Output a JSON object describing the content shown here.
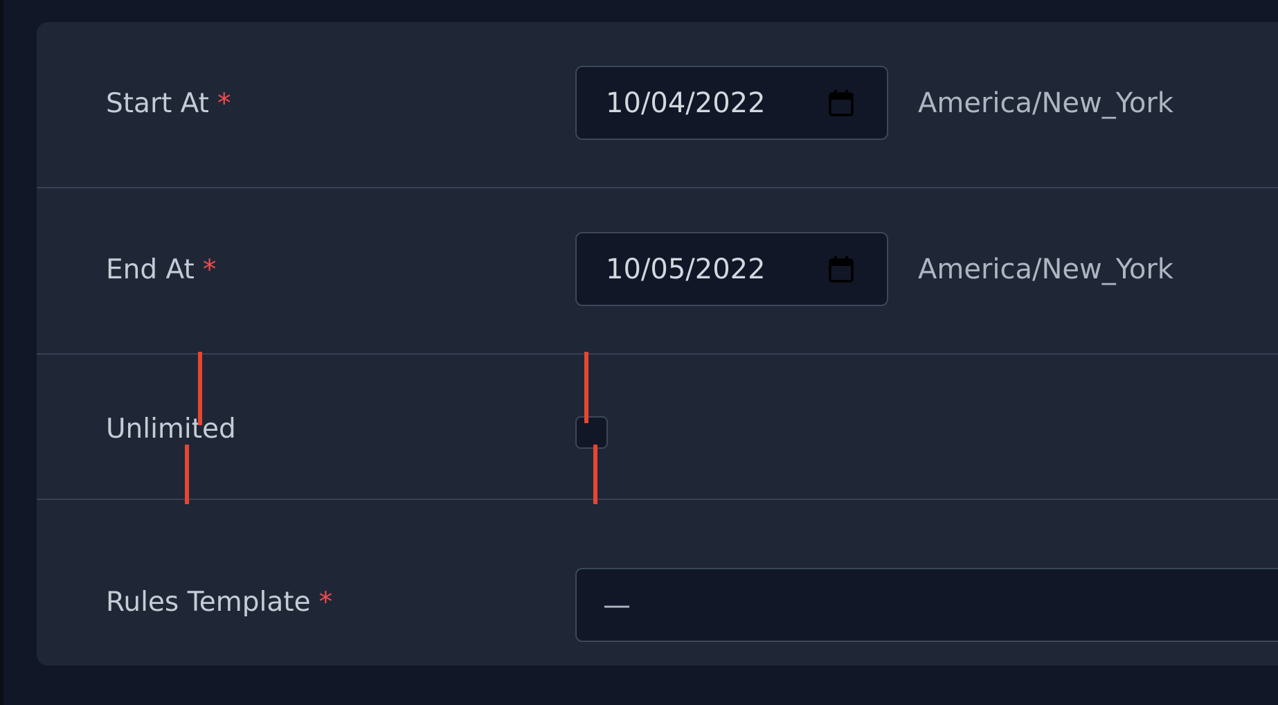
{
  "form": {
    "start_at": {
      "label": "Start At",
      "required_mark": "*",
      "value": "10/04/2022",
      "timezone": "America/New_York"
    },
    "end_at": {
      "label": "End At",
      "required_mark": "*",
      "value": "10/05/2022",
      "timezone": "America/New_York"
    },
    "unlimited": {
      "label": "Unlimited",
      "checked": false
    },
    "rules_template": {
      "label": "Rules Template",
      "required_mark": "*",
      "value": "—"
    }
  },
  "icons": {
    "date_picker": "calendar-icon"
  },
  "colors": {
    "background": "#111727",
    "panel": "#1f2737",
    "input_background": "#111727",
    "input_border": "#3d4759",
    "required": "#ef4b4b",
    "marker": "#e8462f"
  }
}
